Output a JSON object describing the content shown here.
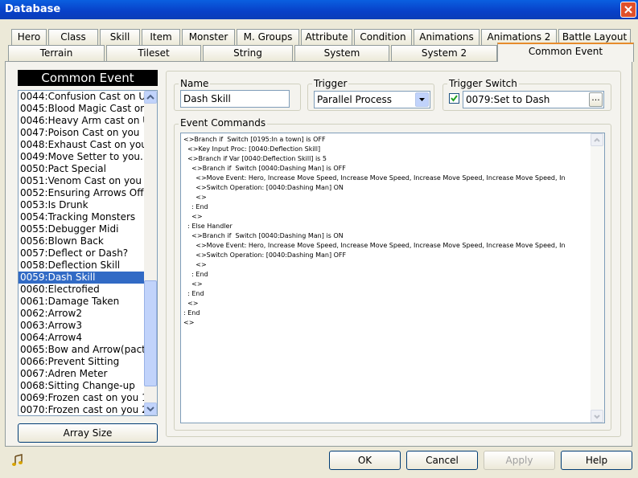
{
  "window": {
    "title": "Database",
    "close_icon": "close-icon"
  },
  "tabs_row1": [
    "Hero",
    "Class",
    "Skill",
    "Item",
    "Monster",
    "M. Groups",
    "Attribute",
    "Condition",
    "Animations",
    "Animations 2",
    "Battle Layout"
  ],
  "tabs_row2": [
    "Terrain",
    "Tileset",
    "String",
    "System",
    "System 2",
    "Common Event"
  ],
  "active_tab": "Common Event",
  "list": {
    "header": "Common Event",
    "items": [
      "0044:Confusion Cast on U",
      "0045:Blood Magic Cast onU",
      "0046:Heavy Arm cast on U",
      "0047:Poison Cast on you",
      "0048:Exhaust Cast on you",
      "0049:Move Setter to you.",
      "0050:Pact Special",
      "0051:Venom Cast on you",
      "0052:Ensuring Arrows Off",
      "0053:Is Drunk",
      "0054:Tracking Monsters",
      "0055:Debugger Midi",
      "0056:Blown Back",
      "0057:Deflect or Dash?",
      "0058:Deflection Skill",
      "0059:Dash Skill",
      "0060:Electrofied",
      "0061:Damage Taken",
      "0062:Arrow2",
      "0063:Arrow3",
      "0064:Arrow4",
      "0065:Bow and Arrow(pact)",
      "0066:Prevent Sitting",
      "0067:Adren Meter",
      "0068:Sitting Change-up",
      "0069:Frozen cast on you 1",
      "0070:Frozen cast on you 2"
    ],
    "selected_index": 15,
    "array_size_label": "Array Size"
  },
  "name": {
    "label": "Name",
    "value": "Dash Skill"
  },
  "trigger": {
    "label": "Trigger",
    "value": "Parallel Process"
  },
  "trigger_switch": {
    "label": "Trigger Switch",
    "checked": true,
    "value": "0079:Set to Dash",
    "browse": "..."
  },
  "event_commands": {
    "label": "Event Commands",
    "lines": [
      "<>Branch if  Switch [0195:In a town] is OFF",
      "  <>Key Input Proc: [0040:Deflection Skill]",
      "  <>Branch if Var [0040:Deflection Skill] is 5",
      "    <>Branch if  Switch [0040:Dashing Man] is OFF",
      "      <>Move Event: Hero, Increase Move Speed, Increase Move Speed, Increase Move Speed, Increase Move Speed, In",
      "      <>Switch Operation: [0040:Dashing Man] ON",
      "      <>",
      "    : End",
      "    <>",
      "  : Else Handler",
      "    <>Branch if  Switch [0040:Dashing Man] is ON",
      "      <>Move Event: Hero, Increase Move Speed, Increase Move Speed, Increase Move Speed, Increase Move Speed, In",
      "      <>Switch Operation: [0040:Dashing Man] OFF",
      "      <>",
      "    : End",
      "    <>",
      "  : End",
      "  <>",
      ": End",
      "<>"
    ]
  },
  "footer": {
    "ok": "OK",
    "cancel": "Cancel",
    "apply": "Apply",
    "help": "Help",
    "music_icon": "music-note-icon"
  },
  "colors": {
    "title_bar": "#0a4fd8",
    "selection": "#316ac5",
    "active_tab_accent": "#e68b2c"
  }
}
